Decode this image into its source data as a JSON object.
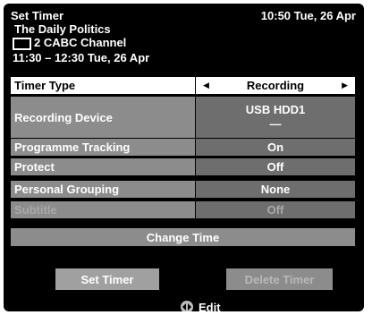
{
  "header": {
    "title": "Set Timer",
    "datetime": "10:50 Tue, 26 Apr",
    "programme": "The Daily Politics",
    "channel": "2 CABC Channel",
    "slot": "11:30 – 12:30 Tue, 26 Apr"
  },
  "settings": {
    "timer_type": {
      "label": "Timer Type",
      "value": "Recording"
    },
    "recording_device": {
      "label": "Recording Device",
      "value": "USB HDD1",
      "sub": "—"
    },
    "programme_tracking": {
      "label": "Programme Tracking",
      "value": "On"
    },
    "protect": {
      "label": "Protect",
      "value": "Off"
    },
    "personal_grouping": {
      "label": "Personal Grouping",
      "value": "None"
    },
    "subtitle": {
      "label": "Subtitle",
      "value": "Off"
    }
  },
  "change_time": "Change Time",
  "buttons": {
    "set_timer": "Set Timer",
    "delete_timer": "Delete Timer"
  },
  "footer": {
    "edit": "Edit"
  },
  "icons": {
    "channel": "channel-box-icon",
    "left": "arrow-left-icon",
    "right": "arrow-right-icon",
    "edit": "left-right-dpad-icon"
  },
  "colors": {
    "panel": "#000000",
    "label_bg": "#8c8c8c",
    "value_bg": "#6e6e6e",
    "selected_bg": "#ffffff"
  }
}
